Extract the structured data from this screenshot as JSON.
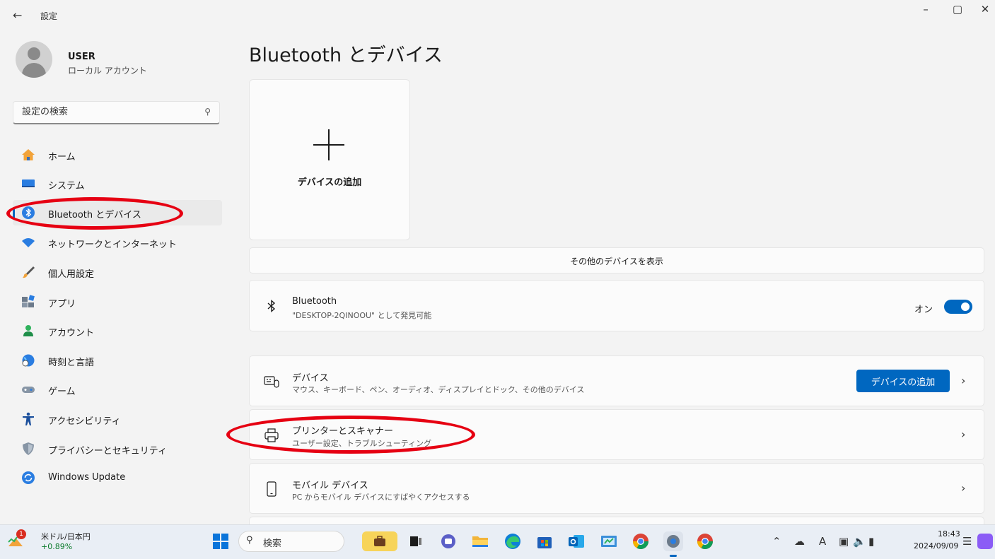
{
  "window": {
    "title": "設定",
    "back": "←",
    "minimize": "–",
    "restore": "▢",
    "close": "✕"
  },
  "user": {
    "name": "USER",
    "account_type": "ローカル アカウント"
  },
  "search": {
    "placeholder": "設定の検索"
  },
  "nav": [
    {
      "id": "home",
      "label": "ホーム"
    },
    {
      "id": "system",
      "label": "システム"
    },
    {
      "id": "bluetooth",
      "label": "Bluetooth とデバイス",
      "active": true
    },
    {
      "id": "network",
      "label": "ネットワークとインターネット"
    },
    {
      "id": "personalization",
      "label": "個人用設定"
    },
    {
      "id": "apps",
      "label": "アプリ"
    },
    {
      "id": "accounts",
      "label": "アカウント"
    },
    {
      "id": "time",
      "label": "時刻と言語"
    },
    {
      "id": "gaming",
      "label": "ゲーム"
    },
    {
      "id": "accessibility",
      "label": "アクセシビリティ"
    },
    {
      "id": "privacy",
      "label": "プライバシーとセキュリティ"
    },
    {
      "id": "update",
      "label": "Windows Update"
    }
  ],
  "main": {
    "title": "Bluetooth とデバイス",
    "add_tile_label": "デバイスの追加",
    "show_more": "その他のデバイスを表示",
    "bluetooth": {
      "title": "Bluetooth",
      "subtitle": "\"DESKTOP-2QINOOU\" として発見可能",
      "state_label": "オン",
      "enabled": true
    },
    "rows": [
      {
        "id": "devices",
        "title": "デバイス",
        "subtitle": "マウス、キーボード、ペン、オーディオ、ディスプレイとドック、その他のデバイス",
        "button": "デバイスの追加"
      },
      {
        "id": "printers",
        "title": "プリンターとスキャナー",
        "subtitle": "ユーザー設定、トラブルシューティング"
      },
      {
        "id": "mobile",
        "title": "モバイル デバイス",
        "subtitle": "PC からモバイル デバイスにすばやくアクセスする"
      }
    ]
  },
  "colors": {
    "accent": "#0067c0",
    "highlight": "#e60012",
    "background": "#f3f3f3"
  },
  "taskbar": {
    "weather": {
      "title": "米ドル/日本円",
      "change": "+0.89%",
      "badge": "1"
    },
    "search_label": "検索",
    "time": "18:43",
    "date": "2024/09/09"
  }
}
